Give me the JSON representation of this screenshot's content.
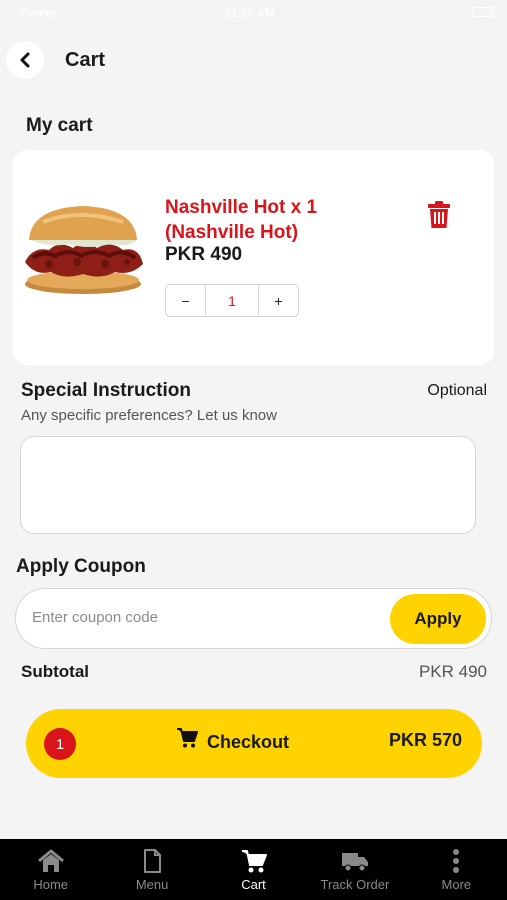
{
  "status_bar": {
    "carrier": "Carrier",
    "time": "11:18 AM"
  },
  "header": {
    "title": "Cart"
  },
  "my_cart": {
    "title": "My cart"
  },
  "item": {
    "name": "Nashville Hot x 1 (Nashville Hot)",
    "price": "PKR 490",
    "quantity": "1",
    "minus": "−",
    "plus": "+"
  },
  "special_instruction": {
    "title": "Special Instruction",
    "optional": "Optional",
    "subtitle": "Any specific preferences? Let us know",
    "value": ""
  },
  "coupon": {
    "title": "Apply Coupon",
    "placeholder": "Enter coupon code",
    "apply_label": "Apply"
  },
  "subtotal": {
    "label": "Subtotal",
    "value": "PKR 490"
  },
  "checkout": {
    "count": "1",
    "label": "Checkout",
    "amount": "PKR 570"
  },
  "nav": {
    "home": "Home",
    "menu": "Menu",
    "cart": "Cart",
    "track_order": "Track Order",
    "more": "More"
  },
  "colors": {
    "accent": "#ffd300",
    "brand_red": "#d9141b",
    "nav_bg": "#000000"
  }
}
